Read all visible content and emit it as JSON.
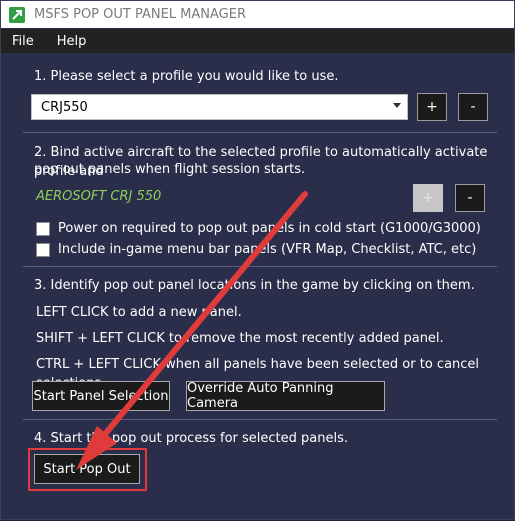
{
  "window": {
    "title": "MSFS POP OUT PANEL MANAGER"
  },
  "menu": {
    "file": "File",
    "help": "Help"
  },
  "step1": {
    "text": "1. Please select a profile you would like to use.",
    "selected_profile": "CRJ550",
    "add_label": "+",
    "remove_label": "-"
  },
  "step2": {
    "text_line1": "2. Bind active aircraft to the selected profile to automatically activate profile and",
    "text_line2": "pop out panels when flight session starts.",
    "aircraft": "AEROSOFT CRJ 550",
    "bind_add_label": "+",
    "bind_remove_label": "-",
    "checkbox1": "Power on required to pop out panels in cold start (G1000/G3000)",
    "checkbox2": "Include in-game menu bar panels (VFR Map, Checklist, ATC, etc)"
  },
  "step3": {
    "text": "3. Identify pop out panel locations in the game by clicking on them.",
    "left_click": "LEFT CLICK  to add a new panel.",
    "shift_click": "SHIFT + LEFT CLICK  to remove the most recently added panel.",
    "ctrl_click": "CTRL + LEFT CLICK  when all panels have been selected or to cancel selections.",
    "start_selection": "Start Panel Selection",
    "override_camera": "Override Auto Panning Camera"
  },
  "step4": {
    "text": "4. Start the pop out process for selected panels.",
    "start_pop_out": "Start Pop Out"
  },
  "colors": {
    "background": "#2a2e4a",
    "aircraft_text": "#8bd05a",
    "annotation_red": "#e03b3b"
  }
}
